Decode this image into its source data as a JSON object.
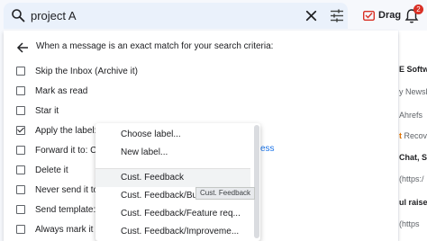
{
  "search": {
    "query": "project A"
  },
  "toolbar": {
    "drag_label": "Drag",
    "notification_count": "2"
  },
  "filter": {
    "header": "When a message is an exact match for your search criteria:",
    "options": [
      {
        "label": "Skip the Inbox (Archive it)",
        "checked": false
      },
      {
        "label": "Mark as read",
        "checked": false
      },
      {
        "label": "Star it",
        "checked": false
      },
      {
        "label": "Apply the label:",
        "checked": true
      },
      {
        "label": "Forward it to: Ch",
        "checked": false
      },
      {
        "label": "Delete it",
        "checked": false
      },
      {
        "label": "Never send it to S",
        "checked": false
      },
      {
        "label": "Send template: C",
        "checked": false
      },
      {
        "label": "Always mark it as",
        "checked": false
      }
    ],
    "forward_link_tail": "ess"
  },
  "label_menu": {
    "items": [
      "Choose label...",
      "New label...",
      "Cust. Feedback",
      "Cust. Feedback/Bug",
      "Cust. Feedback/Feature req...",
      "Cust. Feedback/Improveme..."
    ],
    "tooltip": "Cust. Feedback"
  },
  "bg_list": {
    "items": [
      {
        "text": "E Softwa",
        "style": "bold"
      },
      {
        "text": "y Newsle",
        "style": "normal"
      },
      {
        "text": "Ahrefs",
        "style": "normal"
      },
      {
        "prefix": "t",
        "text": " Recove",
        "style": "orange"
      },
      {
        "text": "Chat, Sc",
        "style": "bold"
      },
      {
        "text": "(https:/",
        "style": "normal"
      },
      {
        "text": "ul raise",
        "style": "bold"
      },
      {
        "text": "(https",
        "style": "normal"
      }
    ]
  }
}
